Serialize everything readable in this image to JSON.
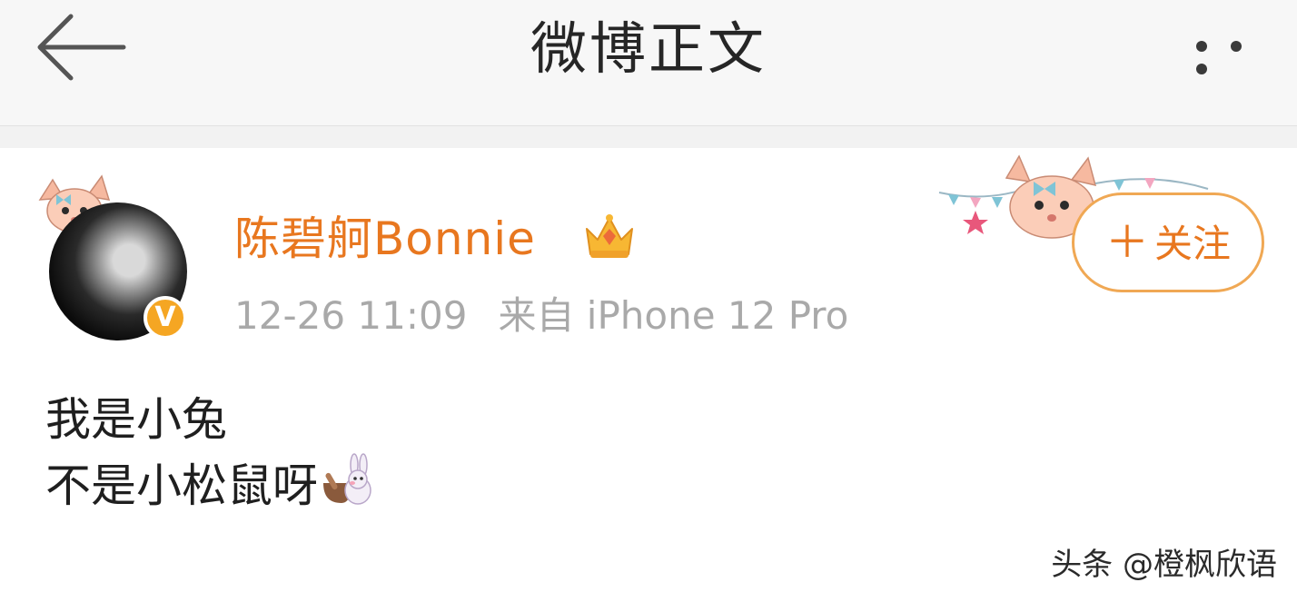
{
  "header": {
    "title": "微博正文",
    "back_icon": "arrow-left-icon",
    "more_icon": "more-horizontal-icon"
  },
  "post": {
    "author": {
      "name": "陈碧舸Bonnie",
      "verified_icon": "verified-v-icon",
      "verified_text": "V",
      "member_icon": "crown-member-icon"
    },
    "time": "12-26 11:09",
    "source": "来自 iPhone 12 Pro",
    "follow_label": "关注",
    "follow_plus": "＋",
    "content_lines": [
      "我是小兔",
      "不是小松鼠呀"
    ],
    "content_emoji": "rabbit-emoji"
  },
  "watermark": "头条 @橙枫欣语",
  "colors": {
    "accent": "#e8771f",
    "follow_border": "#f0a854",
    "badge": "#f5a623",
    "meta_text": "#a9a9a9"
  }
}
